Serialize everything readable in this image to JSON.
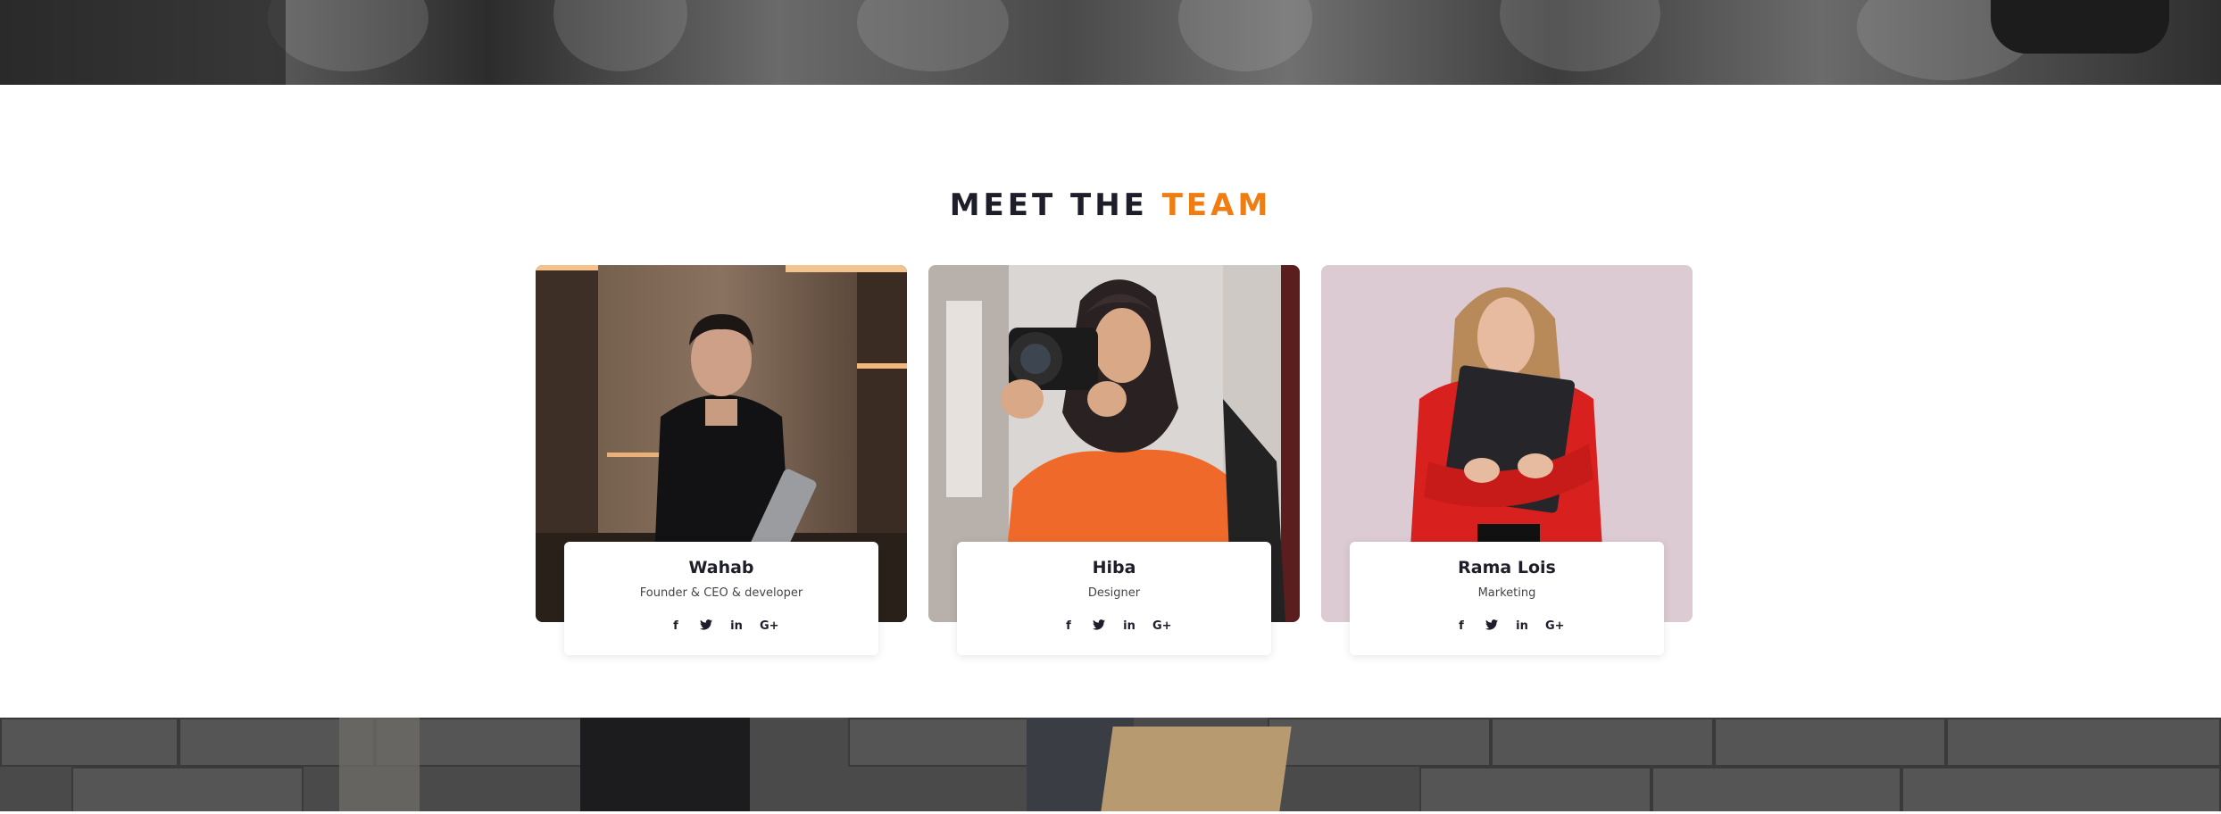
{
  "section": {
    "title_main": "MEET THE",
    "title_accent": "TEAM",
    "accent_color": "#f07d12"
  },
  "team": [
    {
      "name": "Wahab",
      "role": "Founder & CEO & developer",
      "photo": "man in black shirt holding laptop",
      "social": [
        "facebook-icon",
        "twitter-icon",
        "linkedin-icon",
        "google-plus-icon"
      ]
    },
    {
      "name": "Hiba",
      "role": "Designer",
      "photo": "woman in orange jacket with camera",
      "social": [
        "facebook-icon",
        "twitter-icon",
        "linkedin-icon",
        "google-plus-icon"
      ]
    },
    {
      "name": "Rama Lois",
      "role": "Marketing",
      "photo": "woman in red blazer holding folder",
      "social": [
        "facebook-icon",
        "twitter-icon",
        "linkedin-icon",
        "google-plus-icon"
      ]
    }
  ],
  "social_glyphs": {
    "facebook": "f",
    "twitter": "🐦",
    "linkedin": "in",
    "googleplus": "G+"
  }
}
